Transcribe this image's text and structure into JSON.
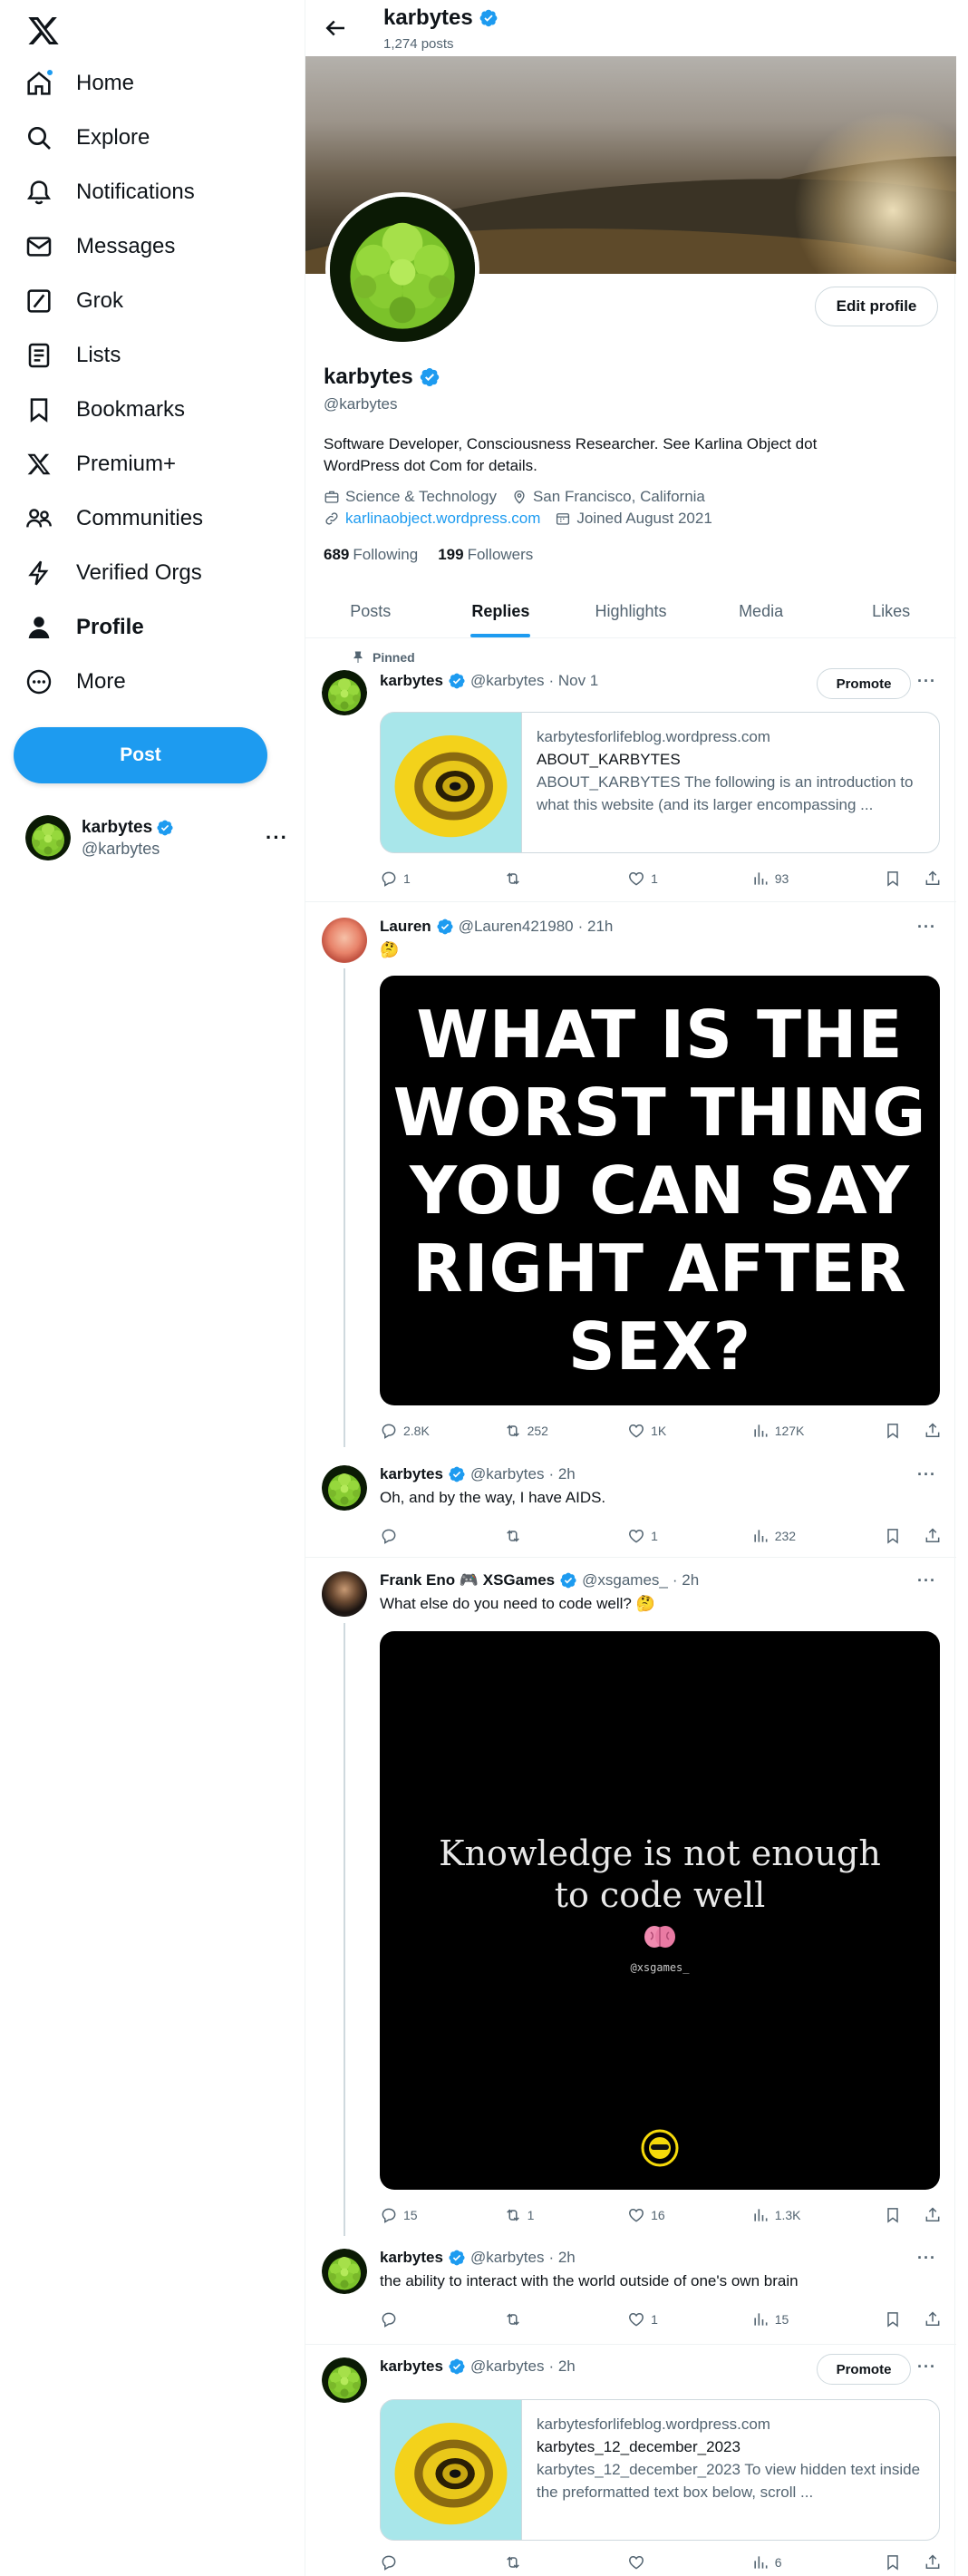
{
  "sidebar": {
    "items": [
      {
        "label": "Home",
        "icon": "home-icon"
      },
      {
        "label": "Explore",
        "icon": "search-icon"
      },
      {
        "label": "Notifications",
        "icon": "bell-icon"
      },
      {
        "label": "Messages",
        "icon": "envelope-icon"
      },
      {
        "label": "Grok",
        "icon": "grok-icon"
      },
      {
        "label": "Lists",
        "icon": "list-icon"
      },
      {
        "label": "Bookmarks",
        "icon": "bookmark-icon"
      },
      {
        "label": "Premium+",
        "icon": "x-icon"
      },
      {
        "label": "Communities",
        "icon": "people-icon"
      },
      {
        "label": "Verified Orgs",
        "icon": "lightning-icon"
      },
      {
        "label": "Profile",
        "icon": "person-icon"
      },
      {
        "label": "More",
        "icon": "more-circle-icon"
      }
    ],
    "post_label": "Post",
    "account": {
      "name": "karbytes",
      "handle": "@karbytes",
      "more": "···"
    }
  },
  "header": {
    "name": "karbytes",
    "posts": "1,274 posts"
  },
  "profile": {
    "edit_label": "Edit profile",
    "name": "karbytes",
    "handle": "@karbytes",
    "bio_line1": "Software Developer, Consciousness Researcher. See Karlina Object dot",
    "bio_line2": "WordPress dot Com for details.",
    "category": "Science & Technology",
    "location": "San Francisco, California",
    "website": "karlinaobject.wordpress.com",
    "joined": "Joined August 2021",
    "following_count": "689",
    "following_label": "Following",
    "followers_count": "199",
    "followers_label": "Followers"
  },
  "tabs": [
    "Posts",
    "Replies",
    "Highlights",
    "Media",
    "Likes"
  ],
  "tweets": [
    {
      "pinned_label": "Pinned",
      "name": "karbytes",
      "handle": "@karbytes",
      "time": "· Nov 1",
      "promote": "Promote",
      "card": {
        "domain": "karbytesforlifeblog.wordpress.com",
        "title": "ABOUT_KARBYTES",
        "desc": "ABOUT_KARBYTES The following is an introduction to what this website (and its larger encompassing ..."
      },
      "stats": {
        "replies": "1",
        "reposts": "",
        "likes": "1",
        "views": "93"
      }
    },
    {
      "name": "Lauren",
      "handle": "@Lauren421980",
      "time": "· 21h",
      "text": "🤔",
      "media_text": [
        "WHAT IS THE",
        "WORST THING",
        "YOU CAN SAY",
        "RIGHT AFTER",
        "SEX?"
      ],
      "stats": {
        "replies": "2.8K",
        "reposts": "252",
        "likes": "1K",
        "views": "127K"
      }
    },
    {
      "name": "karbytes",
      "handle": "@karbytes",
      "time": "· 2h",
      "text": "Oh, and by the way, I have AIDS.",
      "stats": {
        "replies": "",
        "reposts": "",
        "likes": "1",
        "views": "232"
      }
    },
    {
      "name": "Frank Eno 🎮 XSGames",
      "handle": "@xsgames_",
      "time": "· 2h",
      "text": "What else do you need to code well? 🤔",
      "media_text": [
        "Knowledge is not enough",
        "to code well"
      ],
      "media_handle": "@xsgames_",
      "stats": {
        "replies": "15",
        "reposts": "1",
        "likes": "16",
        "views": "1.3K"
      }
    },
    {
      "name": "karbytes",
      "handle": "@karbytes",
      "time": "· 2h",
      "text": "the ability to interact with the world outside of one's own brain",
      "stats": {
        "replies": "",
        "reposts": "",
        "likes": "1",
        "views": "15"
      }
    },
    {
      "name": "karbytes",
      "handle": "@karbytes",
      "time": "· 2h",
      "promote": "Promote",
      "card": {
        "domain": "karbytesforlifeblog.wordpress.com",
        "title": "karbytes_12_december_2023",
        "desc": "karbytes_12_december_2023 To view hidden text inside the preformatted text box below, scroll ..."
      },
      "stats": {
        "replies": "",
        "reposts": "",
        "likes": "",
        "views": "6"
      }
    }
  ],
  "colors": {
    "accent": "#1d9bf0",
    "text": "#0f1419",
    "muted": "#536471",
    "border": "#eff3f4"
  }
}
